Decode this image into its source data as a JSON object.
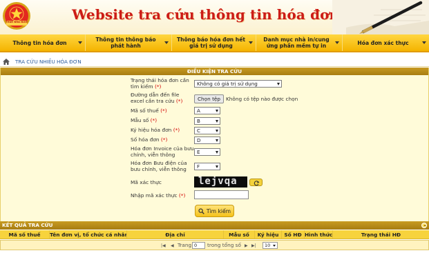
{
  "header": {
    "site_title": "Website tra cứu thông tin hóa đơn",
    "emblem_text": "THUẾ NHÀ NƯỚC"
  },
  "nav": {
    "items": [
      {
        "label": "Thông tin hóa đơn"
      },
      {
        "label": "Thông tin thông báo phát hành"
      },
      {
        "label": "Thông báo hóa đơn hết giá trị sử dụng"
      },
      {
        "label": "Danh mục nhà in/cung ứng phần mềm tự in"
      },
      {
        "label": "Hóa đơn xác thực"
      }
    ]
  },
  "breadcrumb": {
    "label": "TRA CỨU NHIỀU HÓA ĐƠN"
  },
  "search": {
    "title": "ĐIỀU KIỆN TRA CỨU",
    "fields": {
      "status": {
        "label": "Trạng thái hóa đơn cần tìm kiếm",
        "req": "(*)",
        "value": "Không có giá trị sử dụng"
      },
      "file": {
        "label": "Đường dẫn đến file excel cần tra cứu",
        "req": "(*)",
        "button": "Chọn tệp",
        "status": "Không có tệp nào được chọn"
      },
      "tax_code": {
        "label": "Mã số thuế",
        "req": "(*)",
        "value": "A"
      },
      "form_code": {
        "label": "Mẫu số",
        "req": "(*)",
        "value": "B"
      },
      "symbol": {
        "label": "Ký hiệu hóa đơn",
        "req": "(*)",
        "value": "C"
      },
      "number": {
        "label": "Số hóa đơn",
        "req": "(*)",
        "value": "D"
      },
      "postal_invoice": {
        "label": "Hóa đơn Invoice của bưu chính, viễn thông",
        "value": "E"
      },
      "postal_receipt": {
        "label": "Hóa đơn Bưu điện của bưu chính, viễn thông",
        "value": "F"
      },
      "captcha": {
        "label": "Mã xác thực",
        "image_text": "lejvqa"
      },
      "captcha_input": {
        "label": "Nhập mã xác thực",
        "req": "(*)",
        "value": ""
      }
    },
    "submit_label": "Tìm kiếm"
  },
  "results": {
    "title": "KẾT QUẢ TRA CỨU",
    "columns": [
      "Mã số thuế",
      "Tên đơn vị, tổ chức cá nhân",
      "Địa chỉ",
      "Mẫu số",
      "Ký hiệu",
      "Số HĐ",
      "Hình thức",
      "Trạng thái HĐ"
    ],
    "pager": {
      "page_label": "Trang",
      "page_value": "0",
      "total_label": "trong tổng số",
      "page_size": "10"
    }
  },
  "colors": {
    "brand_red": "#cc1c17",
    "nav_yellow": "#f4b400",
    "panel_brown": "#b88a18",
    "panel_bg": "#fffbd9"
  }
}
